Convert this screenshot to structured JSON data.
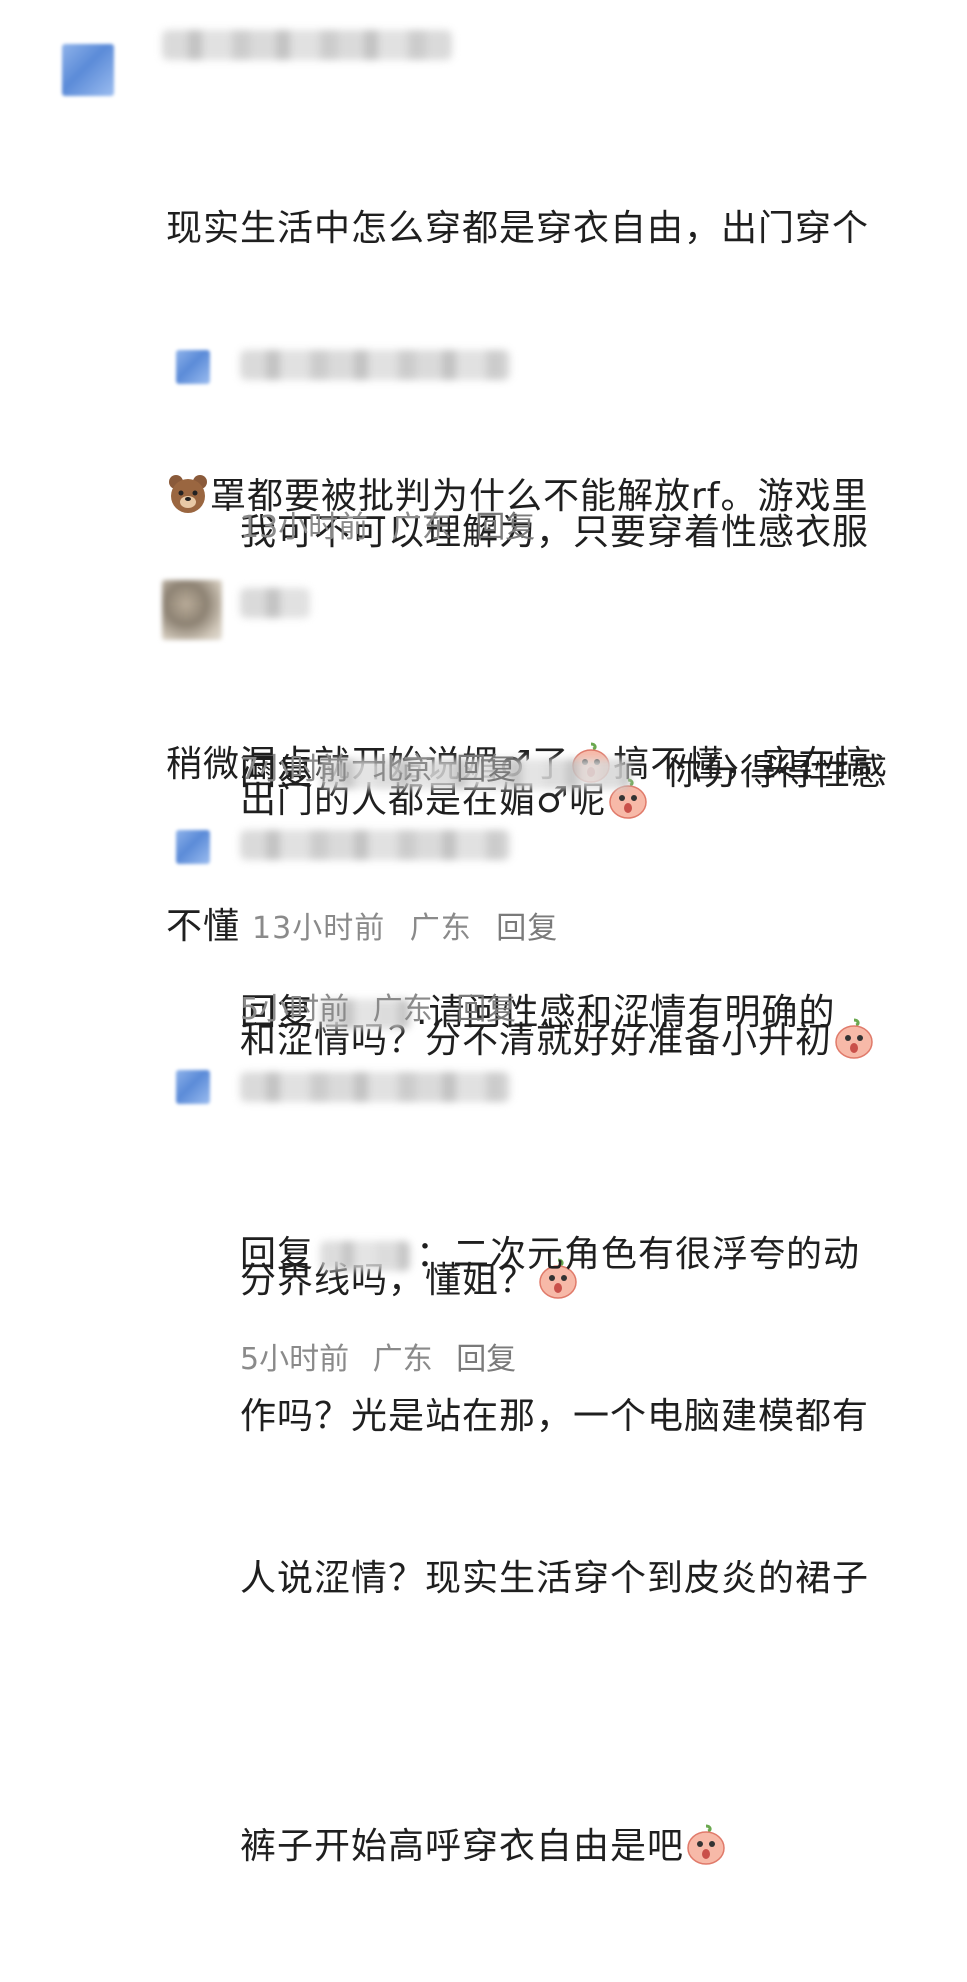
{
  "comments": [
    {
      "text_lines": [
        "现实生活中怎么穿都是穿衣自由，出门穿个",
        "罩都要被批判为什么不能解放rf。游戏里",
        "稍微漏点就开始说媚♂了",
        "搞不懂，实在搞",
        "不懂"
      ],
      "time": "13小时前",
      "location": "广东",
      "reply_label": "回复"
    },
    {
      "text_lines": [
        "我可不可以理解为，只要穿着性感衣服",
        "出门的人都是在媚♂呢"
      ],
      "time": "13小时前",
      "location": "广东",
      "reply_label": "回复"
    },
    {
      "reply_prefix": "回复",
      "text_lines": [
        "你分得得性感",
        "和涩情吗？分不清就好好准备小升初"
      ],
      "time": "7小时前",
      "location": "北京",
      "reply_label": "回复"
    },
    {
      "reply_prefix": "回复",
      "text_lines": ".请问性感和涩情有明确的",
      "text_line2": "分界线吗，懂姐？",
      "time": "5小时前",
      "location": "广东",
      "reply_label": "回复"
    },
    {
      "reply_prefix": "回复",
      "text_first": "：二次元角色有很浮夸的动",
      "text_lines": [
        "作吗？光是站在那，一个电脑建模都有",
        "人说涩情？现实生活穿个到皮炎的裙子",
        "裤子开始高呼穿衣自由是吧"
      ],
      "time": "5小时前",
      "location": "广东",
      "reply_label": "回复"
    }
  ],
  "icons": {
    "peach": "peach-face-emoji-icon",
    "bear": "bear-emoji-icon"
  },
  "colors": {
    "text": "#1f1f1f",
    "meta": "#8a8a8a",
    "avatar_blue": "#5b8bd8"
  }
}
